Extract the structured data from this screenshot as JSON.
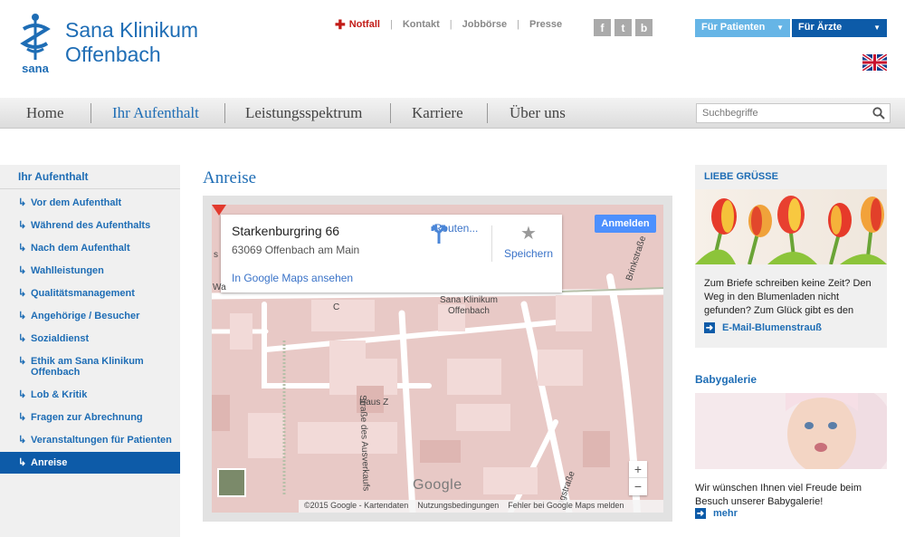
{
  "header": {
    "brand_line1": "Sana Klinikum",
    "brand_line2": "Offenbach",
    "logo_text": "sana",
    "topnav": [
      "Notfall",
      "Kontakt",
      "Jobbörse",
      "Presse"
    ],
    "social": [
      "f",
      "t",
      "b"
    ],
    "btn_patienten": "Für Patienten",
    "btn_aerzte": "Für Ärzte",
    "colors": {
      "brand_blue": "#1e6db5",
      "dark_blue": "#0d5ba8",
      "light_blue": "#66b5e6",
      "notfall_red": "#c21b17"
    }
  },
  "mainnav": {
    "items": [
      "Home",
      "Ihr Aufenthalt",
      "Leistungsspektrum",
      "Karriere",
      "Über uns"
    ],
    "active": "Ihr Aufenthalt",
    "search_placeholder": "Suchbegriffe"
  },
  "sidebar": {
    "heading": "Ihr Aufenthalt",
    "items": [
      "Vor dem Aufenthalt",
      "Während des Aufenthalts",
      "Nach dem Aufenthalt",
      "Wahlleistungen",
      "Qualitätsmanagement",
      "Angehörige / Besucher",
      "Sozialdienst",
      "Ethik am Sana Klinikum Offenbach",
      "Lob & Kritik",
      "Fragen zur Abrechnung",
      "Veranstaltungen für Patienten",
      "Anreise"
    ],
    "active": "Anreise"
  },
  "content": {
    "title": "Anreise",
    "map": {
      "address_line1": "Starkenburgring 66",
      "address_line2": "63069 Offenbach am Main",
      "gm_link": "In Google Maps ansehen",
      "route_label": "Routen...",
      "save_label": "Speichern",
      "signin": "Anmelden",
      "labels": {
        "hospital": "Sana Klinikum\nOffenbach",
        "haus_z": "Haus Z",
        "c": "C",
        "street1": "Straße des Ausverkaufs",
        "street2": "Brinkstraße",
        "street3": "ngstraße",
        "left_s": "s",
        "left_wa": "Wa"
      },
      "google": "Google",
      "zoom_in": "+",
      "zoom_out": "−",
      "footer": [
        "©2015 Google - Kartendaten",
        "Nutzungsbedingungen",
        "Fehler bei Google Maps melden"
      ]
    }
  },
  "right": {
    "box1": {
      "heading": "LIEBE GRÜSSE",
      "text": "Zum Briefe schreiben keine Zeit? Den Weg in den Blumenladen nicht gefunden? Zum Glück gibt es den",
      "link": "E-Mail-Blumenstrauß"
    },
    "box2": {
      "heading": "Babygalerie",
      "text": "Wir wünschen Ihnen viel Freude beim Besuch unserer Babygalerie!",
      "link": "mehr"
    }
  }
}
